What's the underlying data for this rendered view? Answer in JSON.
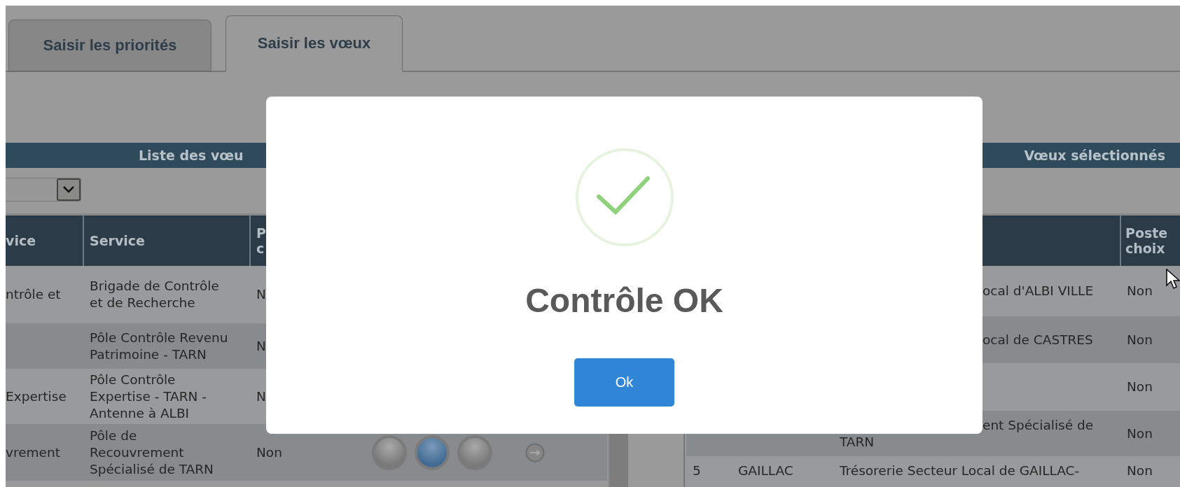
{
  "tabs": [
    {
      "label": "Saisir les priorités",
      "selected": false
    },
    {
      "label": "Saisir les vœux",
      "selected": true
    }
  ],
  "wish_list": {
    "title": "Liste des vœu",
    "columns": [
      "vice",
      "Service",
      "P c"
    ],
    "rows": [
      {
        "column_1": "ntrôle et",
        "service": "Brigade de Contrôle et de Recherche",
        "column_3": "N"
      },
      {
        "service": "Pôle Contrôle Revenu Patrimoine - TARN",
        "column_3": "N"
      },
      {
        "column_1": "Expertise",
        "service": "Pôle Contrôle Expertise - TARN - Antenne à ALBI",
        "column_3": "N"
      },
      {
        "column_1": "vrement",
        "service": "Pôle de Recouvrement Spécialisé de TARN",
        "column_3": "Non",
        "choices": [
          {
            "selected": false
          },
          {
            "selected": true
          },
          {
            "selected": false
          }
        ]
      }
    ]
  },
  "selected_list": {
    "title": "Vœux sélectionnés",
    "columns": [
      "Poste choix"
    ],
    "rows": [
      {
        "column_3": "ocal d'ALBI VILLE",
        "poste_choix": "Non"
      },
      {
        "column_3": "ocal de CASTRES",
        "poste_choix": "Non"
      },
      {
        "poste_choix": "Non"
      },
      {
        "column_3": "ent Spécialisé de TARN",
        "poste_choix": "Non"
      },
      {
        "column_1": "5",
        "column_2": "GAILLAC",
        "column_3": "Trésorerie Secteur Local de GAILLAC-",
        "poste_choix": "Non"
      }
    ]
  },
  "dialog": {
    "title": "Contrôle OK",
    "button": "Ok"
  }
}
